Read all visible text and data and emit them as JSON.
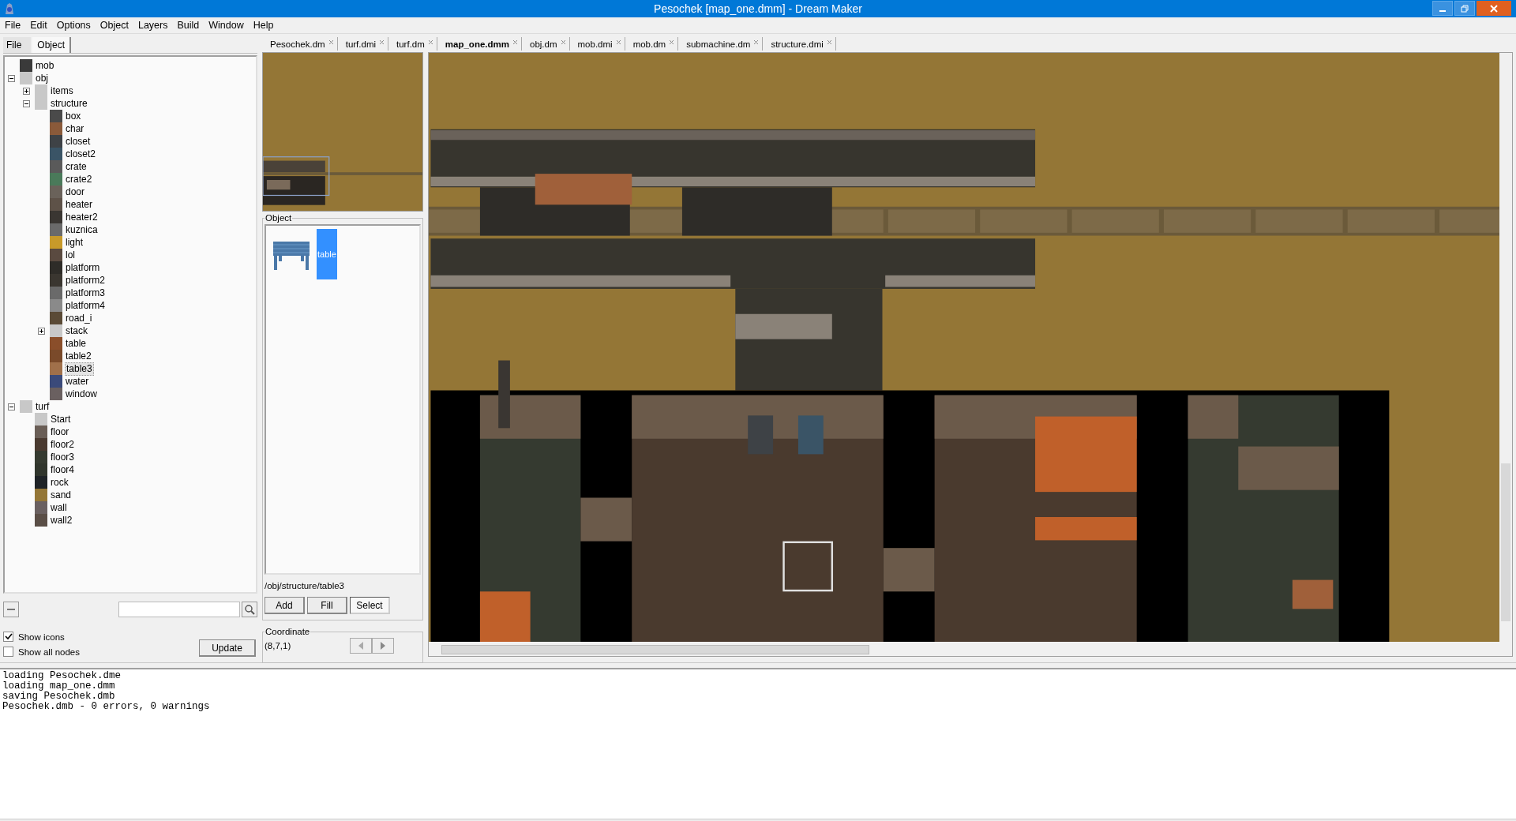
{
  "window": {
    "title": "Pesochek [map_one.dmm] - Dream Maker"
  },
  "menu": [
    "File",
    "Edit",
    "Options",
    "Object",
    "Layers",
    "Build",
    "Window",
    "Help"
  ],
  "side_tabs": [
    {
      "label": "File",
      "selected": false
    },
    {
      "label": "Object",
      "selected": true
    }
  ],
  "tree": [
    {
      "label": "mob",
      "color": "#3a3a3a",
      "selected": false
    },
    {
      "label": "obj",
      "color": "#c8c8c8",
      "selected": false,
      "expanded": true,
      "children": [
        {
          "label": "items",
          "color": "#c8c8c8",
          "selected": false,
          "expanded": false
        },
        {
          "label": "structure",
          "color": "#c8c8c8",
          "selected": false,
          "expanded": true,
          "children": [
            {
              "label": "box",
              "color": "#4a4a4a",
              "selected": false
            },
            {
              "label": "char",
              "color": "#8a5a3a",
              "selected": false
            },
            {
              "label": "closet",
              "color": "#3e4246",
              "selected": false
            },
            {
              "label": "closet2",
              "color": "#3a5466",
              "selected": false
            },
            {
              "label": "crate",
              "color": "#5a5a5a",
              "selected": false
            },
            {
              "label": "crate2",
              "color": "#4a7a5a",
              "selected": false
            },
            {
              "label": "door",
              "color": "#6a625a",
              "selected": false
            },
            {
              "label": "heater",
              "color": "#5e5248",
              "selected": false
            },
            {
              "label": "heater2",
              "color": "#3a3632",
              "selected": false
            },
            {
              "label": "kuznica",
              "color": "#6a6a6a",
              "selected": false
            },
            {
              "label": "light",
              "color": "#c89a2a",
              "selected": false
            },
            {
              "label": "lol",
              "color": "#5a4a40",
              "selected": false
            },
            {
              "label": "platform",
              "color": "#2e2c28",
              "selected": false
            },
            {
              "label": "platform2",
              "color": "#3a3630",
              "selected": false
            },
            {
              "label": "platform3",
              "color": "#6a6a6a",
              "selected": false
            },
            {
              "label": "platform4",
              "color": "#8a8a8a",
              "selected": false
            },
            {
              "label": "road_i",
              "color": "#5a4a36",
              "selected": false
            },
            {
              "label": "stack",
              "color": "#c8c8c8",
              "selected": false,
              "expanded": false
            },
            {
              "label": "table",
              "color": "#8a4e2a",
              "selected": false
            },
            {
              "label": "table2",
              "color": "#7a4a2a",
              "selected": false
            },
            {
              "label": "table3",
              "color": "#a0704a",
              "selected": true
            },
            {
              "label": "water",
              "color": "#3a4a7a",
              "selected": false
            },
            {
              "label": "window",
              "color": "#6a6060",
              "selected": false
            }
          ]
        }
      ]
    },
    {
      "label": "turf",
      "color": "#c8c8c8",
      "selected": false,
      "expanded": true,
      "children": [
        {
          "label": "Start",
          "color": "#c8c8c8",
          "selected": false
        },
        {
          "label": "floor",
          "color": "#6a5e56",
          "selected": false
        },
        {
          "label": "floor2",
          "color": "#4a3a30",
          "selected": false
        },
        {
          "label": "floor3",
          "color": "#353a30",
          "selected": false
        },
        {
          "label": "floor4",
          "color": "#30352c",
          "selected": false
        },
        {
          "label": "rock",
          "color": "#1e2226",
          "selected": false
        },
        {
          "label": "sand",
          "color": "#947636",
          "selected": false
        },
        {
          "label": "wall",
          "color": "#6a6060",
          "selected": false
        },
        {
          "label": "wall2",
          "color": "#5a4e46",
          "selected": false
        }
      ]
    }
  ],
  "options": [
    {
      "label": "Show icons",
      "checked": true
    },
    {
      "label": "Show all nodes",
      "checked": false
    }
  ],
  "update_button": "Update",
  "file_tabs": [
    {
      "label": "Pesochek.dm",
      "selected": false
    },
    {
      "label": "turf.dmi",
      "selected": false
    },
    {
      "label": "turf.dm",
      "selected": false
    },
    {
      "label": "map_one.dmm",
      "selected": true
    },
    {
      "label": "obj.dm",
      "selected": false
    },
    {
      "label": "mob.dmi",
      "selected": false
    },
    {
      "label": "mob.dm",
      "selected": false
    },
    {
      "label": "submachine.dm",
      "selected": false
    },
    {
      "label": "structure.dmi",
      "selected": false
    }
  ],
  "object_panel": {
    "title": "Object",
    "items": [
      {
        "label": "table",
        "selected": true
      }
    ],
    "path": "/obj/structure/table3",
    "buttons": [
      {
        "label": "Add",
        "selected": false
      },
      {
        "label": "Fill",
        "selected": false
      },
      {
        "label": "Select",
        "selected": true
      }
    ]
  },
  "coordinate": {
    "title": "Coordinate",
    "value": "(8,7,1)"
  },
  "console": [
    "loading Pesochek.dme",
    "loading map_one.dmm",
    "saving Pesochek.dmb",
    "Pesochek.dmb - 0 errors, 0 warnings"
  ]
}
